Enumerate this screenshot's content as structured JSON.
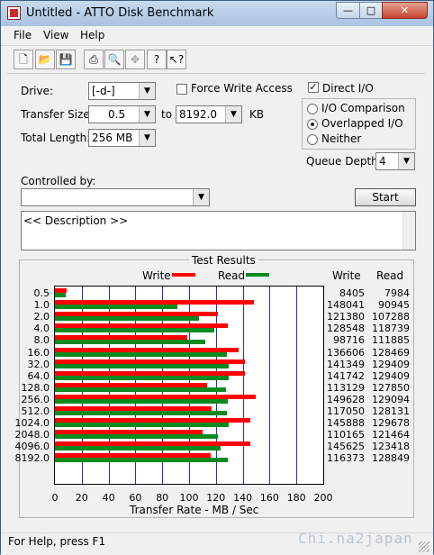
{
  "window": {
    "title": "Untitled - ATTO Disk Benchmark"
  },
  "menu": {
    "file": "File",
    "view": "View",
    "help": "Help"
  },
  "settings": {
    "drive_label": "Drive:",
    "drive_value": "[-d-]",
    "force_write_label": "Force Write Access",
    "force_write_checked": false,
    "direct_io_label": "Direct I/O",
    "direct_io_checked": true,
    "transfer_size_label": "Transfer Size:",
    "transfer_from": "0.5",
    "transfer_to_label": "to",
    "transfer_to": "8192.0",
    "transfer_unit": "KB",
    "total_length_label": "Total Length:",
    "total_length_value": "256 MB",
    "io_comparison_label": "I/O Comparison",
    "overlapped_io_label": "Overlapped I/O",
    "neither_label": "Neither",
    "selected_io_mode": "Overlapped I/O",
    "queue_depth_label": "Queue Depth:",
    "queue_depth_value": "4",
    "controlled_by_label": "Controlled by:",
    "controlled_by_value": "",
    "start_label": "Start",
    "description_text": "<< Description >>"
  },
  "results": {
    "title": "Test Results",
    "write_legend": "Write",
    "read_legend": "Read",
    "write_col_header": "Write",
    "read_col_header": "Read",
    "x_axis_label": "Transfer Rate - MB / Sec",
    "colors": {
      "write": "#ff0000",
      "read": "#0a8a1f",
      "grid": "#1f34c6"
    }
  },
  "chart_data": {
    "type": "bar",
    "title": "Test Results",
    "xlabel": "Transfer Rate - MB / Sec",
    "xlim": [
      0,
      200
    ],
    "xticks": [
      0,
      20,
      40,
      60,
      80,
      100,
      120,
      140,
      160,
      180,
      200
    ],
    "categories": [
      "0.5",
      "1.0",
      "2.0",
      "4.0",
      "8.0",
      "16.0",
      "32.0",
      "64.0",
      "128.0",
      "256.0",
      "512.0",
      "1024.0",
      "2048.0",
      "4096.0",
      "8192.0"
    ],
    "series": [
      {
        "name": "Write",
        "values_kb_per_sec": [
          8405,
          148041,
          121380,
          128548,
          98716,
          136606,
          141349,
          141742,
          113129,
          149628,
          117050,
          145888,
          110165,
          145625,
          116373
        ]
      },
      {
        "name": "Read",
        "values_kb_per_sec": [
          7984,
          90945,
          107288,
          118739,
          111885,
          128469,
          129409,
          129409,
          127850,
          129094,
          128131,
          129678,
          121464,
          123418,
          128849
        ]
      }
    ]
  },
  "status": {
    "text": "For Help, press F1"
  },
  "watermark": "Chi.na2japan"
}
